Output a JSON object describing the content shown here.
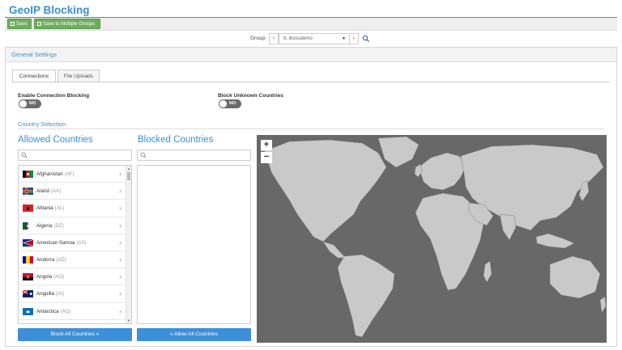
{
  "page": {
    "title": "GeoIP Blocking"
  },
  "toolbar": {
    "save_label": "Save",
    "save_multi_label": "Save to Multiple Groups"
  },
  "group": {
    "label": "Group:",
    "selected": "8. ibossdemo"
  },
  "panel": {
    "title": "General Settings"
  },
  "tabs": [
    {
      "label": "Connections",
      "active": true
    },
    {
      "label": "File Uploads",
      "active": false
    }
  ],
  "options": {
    "enable_connection_blocking": {
      "label": "Enable Connection Blocking",
      "state": "NO"
    },
    "block_unknown_countries": {
      "label": "Block Unknown Countries",
      "state": "NO"
    }
  },
  "country_selection": {
    "title": "Country Selection",
    "allowed_title": "Allowed Countries",
    "blocked_title": "Blocked Countries",
    "allowed": [
      {
        "name": "Afghanistan",
        "code": "(AF)"
      },
      {
        "name": "Aland",
        "code": "(AX)"
      },
      {
        "name": "Albania",
        "code": "(AL)"
      },
      {
        "name": "Algeria",
        "code": "(DZ)"
      },
      {
        "name": "American Samoa",
        "code": "(AS)"
      },
      {
        "name": "Andorra",
        "code": "(AD)"
      },
      {
        "name": "Angola",
        "code": "(AO)"
      },
      {
        "name": "Anguilla",
        "code": "(AI)"
      },
      {
        "name": "Antarctica",
        "code": "(AQ)"
      }
    ],
    "blocked": [],
    "block_all_label": "Block All Countries",
    "allow_all_label": "Allow All Countries"
  },
  "map": {
    "zoom_in": "+",
    "zoom_out": "−",
    "ocean_color": "#686868",
    "land_color": "#c9c9c9"
  },
  "colors": {
    "accent": "#3a8fd6",
    "save_green": "#6dad5e",
    "button_blue": "#3d8fd9"
  }
}
